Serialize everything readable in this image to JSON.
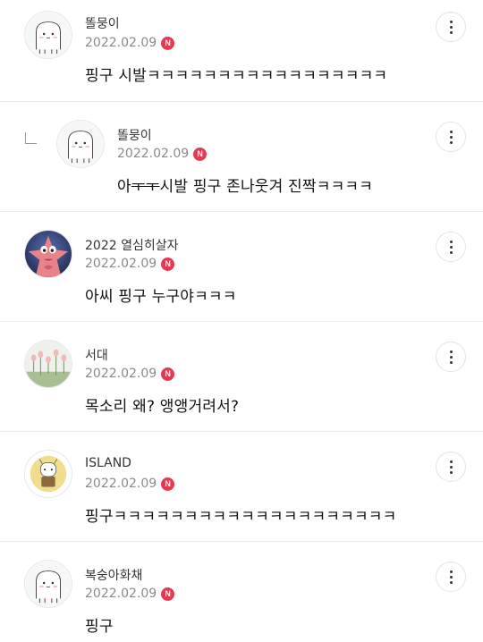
{
  "comments": [
    {
      "author": "똘뭉이",
      "date": "2022.02.09",
      "badge": "N",
      "text": "핑구 시발ㅋㅋㅋㅋㅋㅋㅋㅋㅋㅋㅋㅋㅋㅋㅋㅋㅋ",
      "avatar": "ghost-character"
    },
    {
      "author": "똘뭉이",
      "date": "2022.02.09",
      "badge": "N",
      "text_a": "아",
      "text_strike": "ㅜㅜ",
      "text_b": "시발 핑구 존나웃겨 진짝ㅋㅋㅋㅋ",
      "avatar": "ghost-character",
      "is_reply": true
    },
    {
      "author": "2022 열심히살자",
      "date": "2022.02.09",
      "badge": "N",
      "text": "아씨 핑구 누구야ㅋㅋㅋ",
      "avatar": "patrick-star"
    },
    {
      "author": "서대",
      "date": "2022.02.09",
      "badge": "N",
      "text": "목소리 왜? 앵앵거려서?",
      "avatar": "tulips"
    },
    {
      "author": "ISLAND",
      "date": "2022.02.09",
      "badge": "N",
      "text": "핑구ㅋㅋㅋㅋㅋㅋㅋㅋㅋㅋㅋㅋㅋㅋㅋㅋㅋㅋㅋㅋ",
      "avatar": "isfp-character"
    },
    {
      "author": "복숭아화채",
      "date": "2022.02.09",
      "badge": "N",
      "text": "핑구",
      "avatar": "ghost-character"
    }
  ]
}
